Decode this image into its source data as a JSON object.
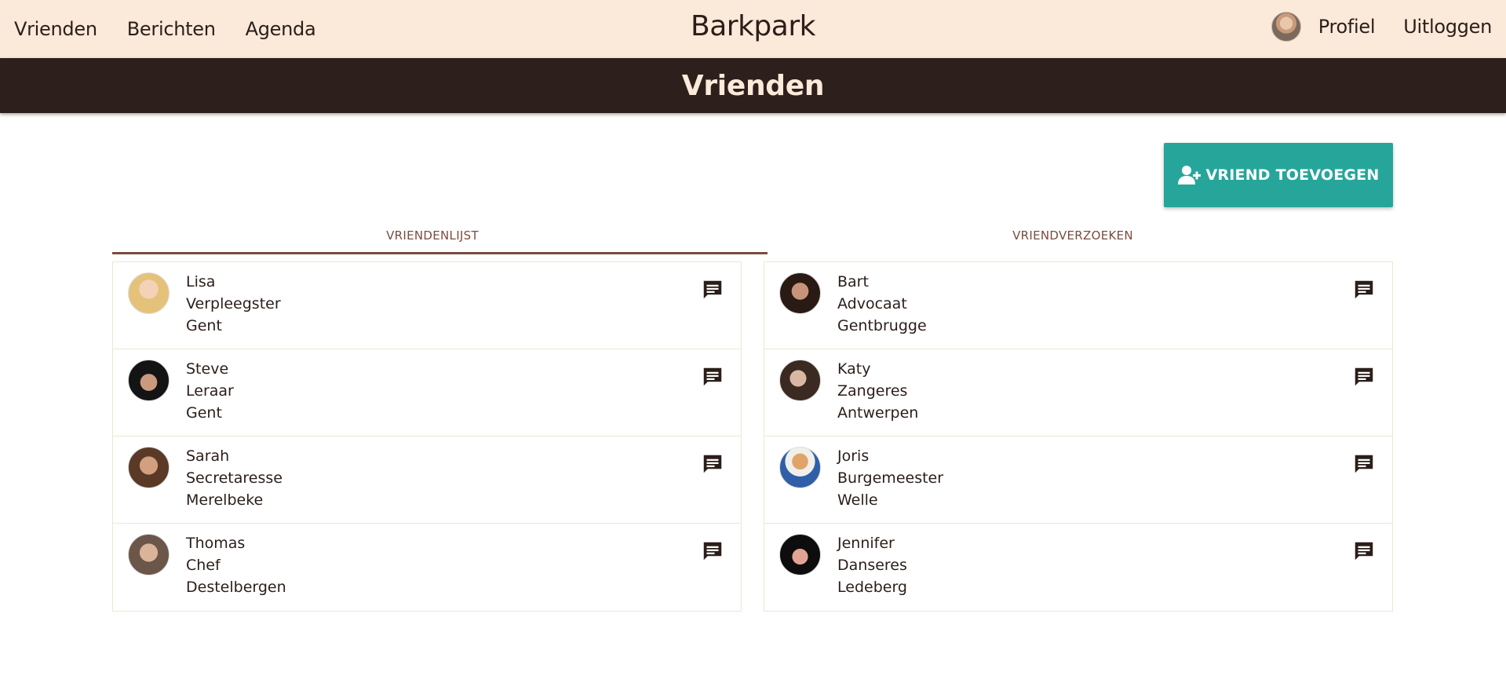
{
  "nav": {
    "links": [
      "Vrienden",
      "Berichten",
      "Agenda"
    ],
    "brand": "Barkpark",
    "profile": "Profiel",
    "logout": "Uitloggen"
  },
  "header": {
    "title": "Vrienden"
  },
  "actions": {
    "add_friend": "VRIEND TOEVOEGEN"
  },
  "tabs": [
    {
      "label": "VRIENDENLIJST",
      "active": true
    },
    {
      "label": "VRIENDVERZOEKEN",
      "active": false
    }
  ],
  "friends_left": [
    {
      "name": "Lisa",
      "job": "Verpleegster",
      "city": "Gent"
    },
    {
      "name": "Steve",
      "job": "Leraar",
      "city": "Gent"
    },
    {
      "name": "Sarah",
      "job": "Secretaresse",
      "city": "Merelbeke"
    },
    {
      "name": "Thomas",
      "job": "Chef",
      "city": "Destelbergen"
    }
  ],
  "friends_right": [
    {
      "name": "Bart",
      "job": "Advocaat",
      "city": "Gentbrugge"
    },
    {
      "name": "Katy",
      "job": "Zangeres",
      "city": "Antwerpen"
    },
    {
      "name": "Joris",
      "job": "Burgemeester",
      "city": "Welle"
    },
    {
      "name": "Jennifer",
      "job": "Danseres",
      "city": "Ledeberg"
    }
  ],
  "colors": {
    "navbar_bg": "#fbe9da",
    "header_bg": "#2d1f1b",
    "accent": "#26a69a",
    "tab_text": "#7a4d3e"
  }
}
